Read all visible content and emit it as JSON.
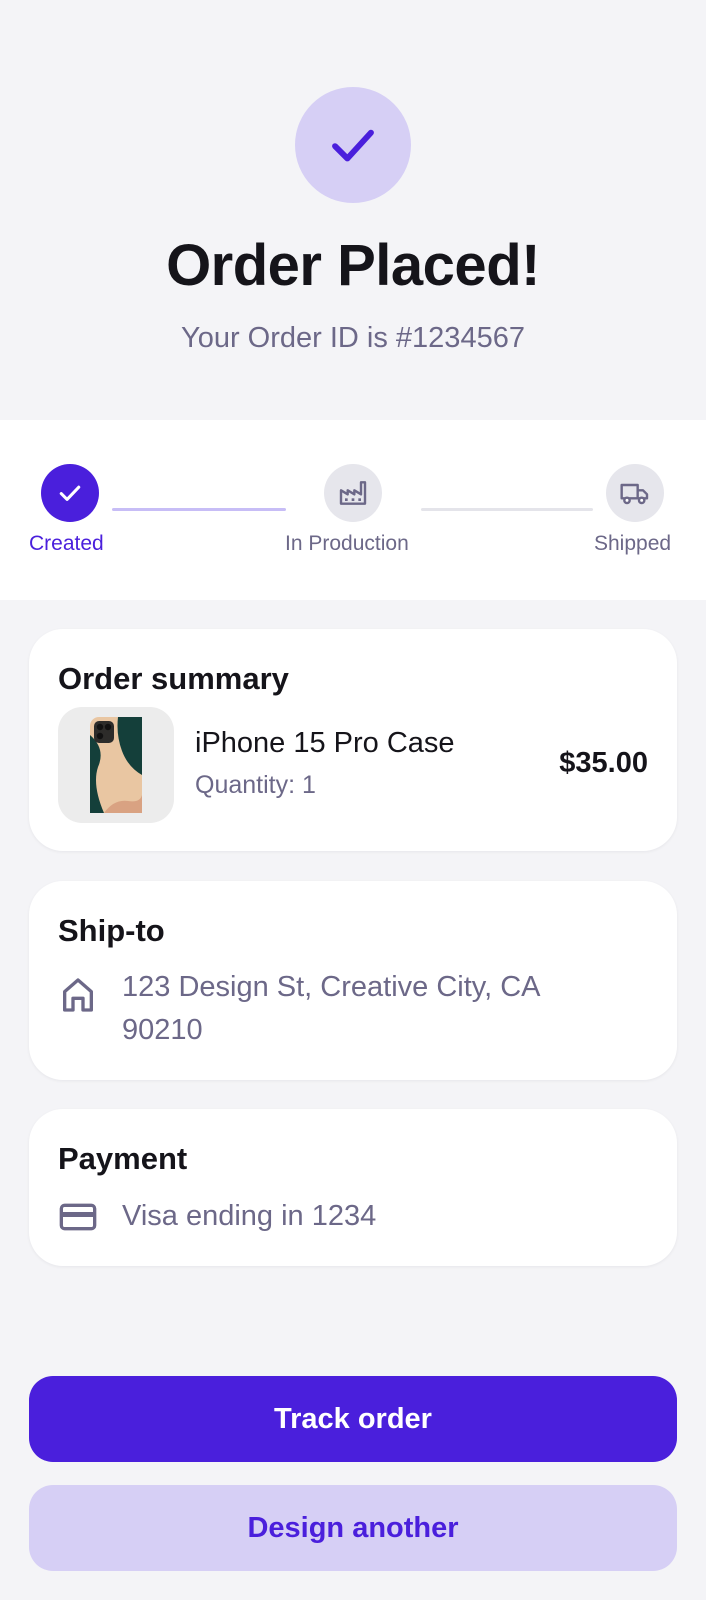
{
  "header": {
    "title": "Order Placed!",
    "subtitle": "Your Order ID is #1234567",
    "icon": "check-icon"
  },
  "stepper": {
    "steps": [
      {
        "label": "Created",
        "status": "done",
        "icon": "check-icon"
      },
      {
        "label": "In Production",
        "status": "pending",
        "icon": "factory-icon"
      },
      {
        "label": "Shipped",
        "status": "pending",
        "icon": "truck-icon"
      }
    ]
  },
  "order_summary": {
    "title": "Order summary",
    "product": {
      "name": "iPhone 15 Pro Case",
      "quantity": "Quantity: 1",
      "price": "$35.00"
    }
  },
  "ship_to": {
    "title": "Ship-to",
    "address_line1": "123 Design St, Creative City, CA",
    "address_line2": "90210",
    "icon": "home-icon"
  },
  "payment": {
    "title": "Payment",
    "method": "Visa ending in 1234",
    "icon": "credit-card-icon"
  },
  "actions": {
    "track_label": "Track order",
    "design_label": "Design another"
  },
  "colors": {
    "accent": "#4a1fdc",
    "accent_light": "#d6cff5",
    "muted_text": "#6c6888",
    "background": "#f4f4f7"
  }
}
